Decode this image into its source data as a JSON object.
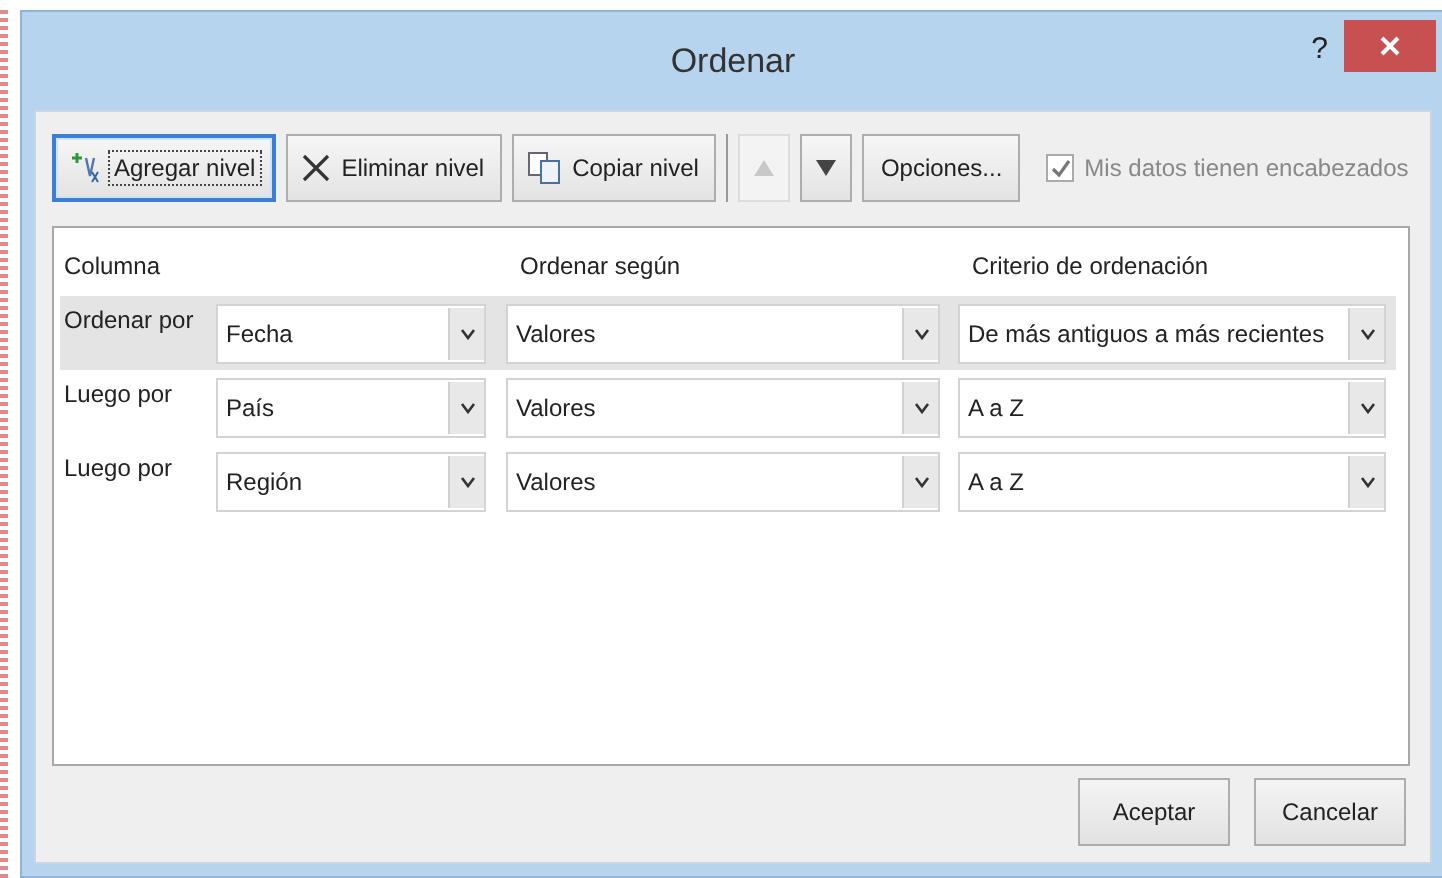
{
  "window": {
    "title": "Ordenar",
    "help": "?"
  },
  "toolbar": [
    {
      "kind": "add",
      "label": "Agregar nivel",
      "disabled": false,
      "focused": true
    },
    {
      "kind": "delete",
      "label": "Eliminar nivel",
      "disabled": false,
      "focused": false
    },
    {
      "kind": "copy",
      "label": "Copiar nivel",
      "disabled": false,
      "focused": false
    },
    {
      "kind": "up",
      "disabled": true,
      "focused": false
    },
    {
      "kind": "down",
      "disabled": false,
      "focused": false
    },
    {
      "kind": "options",
      "label": "Opciones...",
      "disabled": false,
      "focused": false
    }
  ],
  "headers_checkbox": {
    "label": "Mis datos tienen encabezados",
    "checked": true,
    "disabled": true
  },
  "columns": [
    "Columna",
    "Ordenar según",
    "Criterio de ordenación"
  ],
  "levels": [
    {
      "label": "Ordenar por",
      "selected": true,
      "column": "Fecha",
      "sort_on": "Valores",
      "order": "De más antiguos a más recientes"
    },
    {
      "label": "Luego por",
      "selected": false,
      "column": "País",
      "sort_on": "Valores",
      "order": "A a Z"
    },
    {
      "label": "Luego por",
      "selected": false,
      "column": "Región",
      "sort_on": "Valores",
      "order": "A a Z"
    }
  ],
  "buttons": [
    "Aceptar",
    "Cancelar"
  ]
}
